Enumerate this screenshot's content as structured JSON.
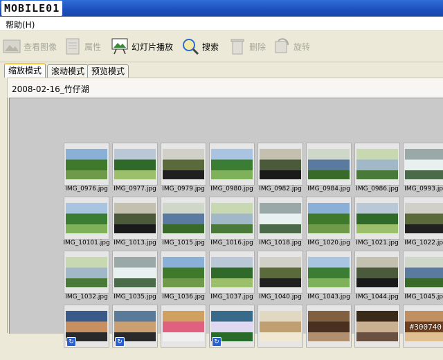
{
  "titlebar": {
    "logo": "MOBILE01"
  },
  "menubar": {
    "help": "帮助(H)"
  },
  "toolbar": {
    "view_image": "查看图像",
    "properties": "属性",
    "slideshow": "幻灯片播放",
    "search": "搜索",
    "delete": "删除",
    "rotate": "旋转"
  },
  "tabs": {
    "zoom": "缩放模式",
    "scroll": "滚动模式",
    "preview": "预览模式"
  },
  "folder": {
    "path": "2008-02-16_竹仔湖"
  },
  "watermark": "#300740",
  "thumbnails": {
    "r1": [
      "IMG_0976.jpg",
      "IMG_0977.jpg",
      "IMG_0979.jpg",
      "IMG_0980.jpg",
      "IMG_0982.jpg",
      "IMG_0984.jpg",
      "IMG_0986.jpg",
      "IMG_0993.jpg"
    ],
    "r2": [
      "IMG_10101.jpg",
      "IMG_1013.jpg",
      "IMG_1015.jpg",
      "IMG_1016.jpg",
      "IMG_1018.jpg",
      "IMG_1020.jpg",
      "IMG_1021.jpg",
      "IMG_1022.jpg"
    ],
    "r3": [
      "IMG_1032.jpg",
      "IMG_1035.jpg",
      "IMG_1036.jpg",
      "IMG_1037.jpg",
      "IMG_1040.jpg",
      "IMG_1043.jpg",
      "IMG_1044.jpg",
      "IMG_1045.jpg"
    ]
  },
  "colors": {
    "titlebar": "#1d4fbc",
    "grid_bg": "#c9c9c9",
    "tab_highlight": "#ffc73c"
  }
}
